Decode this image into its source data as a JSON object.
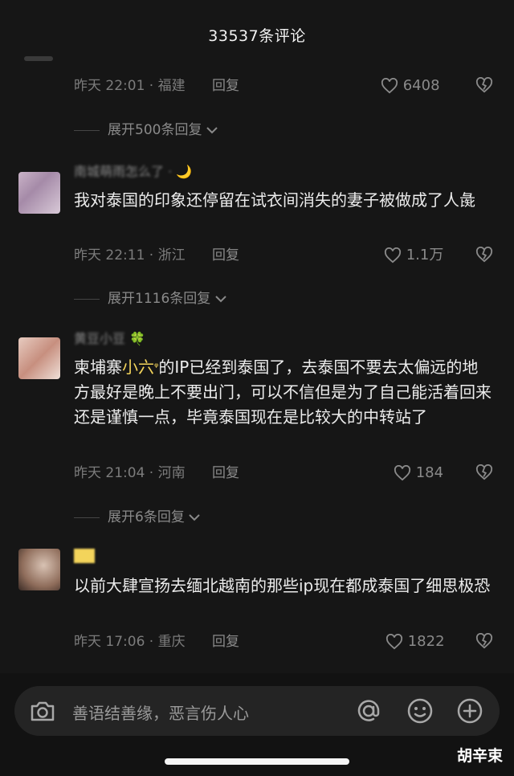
{
  "header": {
    "title": "33537条评论"
  },
  "comments": [
    {
      "username": "",
      "text": "",
      "time": "昨天 22:01 · 福建",
      "reply": "回复",
      "likes": "6408",
      "expand": "展开500条回复"
    },
    {
      "username": "南城萌雨怎么了 ·",
      "emoji": "🌙",
      "text": "我对泰国的印象还停留在试衣间消失的妻子被做成了人彘",
      "time": "昨天 22:11 · 浙江",
      "reply": "回复",
      "likes": "1.1万",
      "expand": "展开1116条回复"
    },
    {
      "username": "黄豆小豆",
      "emoji": "🍀",
      "text_before": "柬埔寨",
      "mention": "小六",
      "text_after": "的IP已经到泰国了，去泰国不要去太偏远的地方最好是晚上不要出门，可以不信但是为了自己能活着回来还是谨慎一点，毕竟泰国现在是比较大的中转站了",
      "time": "昨天 21:04 · 河南",
      "reply": "回复",
      "likes": "184",
      "expand": "展开6条回复"
    },
    {
      "username": "",
      "text": "以前大肆宣扬去缅北越南的那些ip现在都成泰国了细思极恐",
      "time": "昨天 17:06 · 重庆",
      "reply": "回复",
      "likes": "1822"
    }
  ],
  "input": {
    "placeholder": "善语结善缘，恶言伤人心"
  },
  "watermark": "胡辛束",
  "icons": [
    "camera-icon",
    "at-icon",
    "emoji-icon",
    "plus-icon",
    "heart-icon",
    "broken-heart-icon",
    "chevron-down-icon"
  ]
}
